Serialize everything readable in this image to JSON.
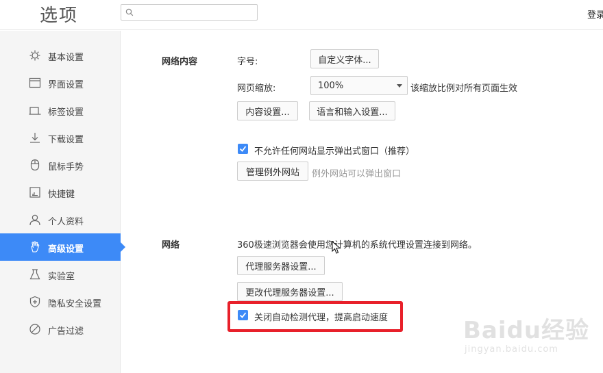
{
  "header": {
    "title": "选项",
    "search_placeholder": "",
    "search_icon": "search-icon",
    "login_label": "登录"
  },
  "sidebar": {
    "items": [
      {
        "label": "基本设置",
        "icon": "gear-icon",
        "active": false
      },
      {
        "label": "界面设置",
        "icon": "window-icon",
        "active": false
      },
      {
        "label": "标签设置",
        "icon": "tab-icon",
        "active": false
      },
      {
        "label": "下载设置",
        "icon": "download-icon",
        "active": false
      },
      {
        "label": "鼠标手势",
        "icon": "mouse-icon",
        "active": false
      },
      {
        "label": "快捷键",
        "icon": "shortcut-icon",
        "active": false
      },
      {
        "label": "个人资料",
        "icon": "user-icon",
        "active": false
      },
      {
        "label": "高级设置",
        "icon": "hand-icon",
        "active": true
      },
      {
        "label": "实验室",
        "icon": "flask-icon",
        "active": false
      },
      {
        "label": "隐私安全设置",
        "icon": "shield-icon",
        "active": false
      },
      {
        "label": "广告过滤",
        "icon": "block-icon",
        "active": false
      }
    ]
  },
  "web_content": {
    "section_label": "网络内容",
    "font_size_label": "字号:",
    "custom_font_button": "自定义字体...",
    "zoom_label": "网页缩放:",
    "zoom_value": "100%",
    "zoom_note": "该缩放比例对所有页面生效",
    "content_settings_button": "内容设置...",
    "language_button": "语言和输入设置...",
    "popup_checkbox_label": "不允许任何网站显示弹出式窗口（推荐）",
    "popup_checked": true,
    "manage_exceptions_button": "管理例外网站",
    "exceptions_note": "例外网站可以弹出窗口"
  },
  "network": {
    "section_label": "网络",
    "description": "360极速浏览器会使用您计算机的系统代理设置连接到网络。",
    "proxy_button": "代理服务器设置...",
    "change_proxy_button": "更改代理服务器设置...",
    "auto_detect_label": "关闭自动检测代理，提高启动速度",
    "auto_detect_checked": true
  },
  "watermark": {
    "main": "Baidu经验",
    "sub": "jingyan.baidu.com"
  },
  "colors": {
    "accent": "#3d8af7",
    "highlight": "#e8202a"
  }
}
